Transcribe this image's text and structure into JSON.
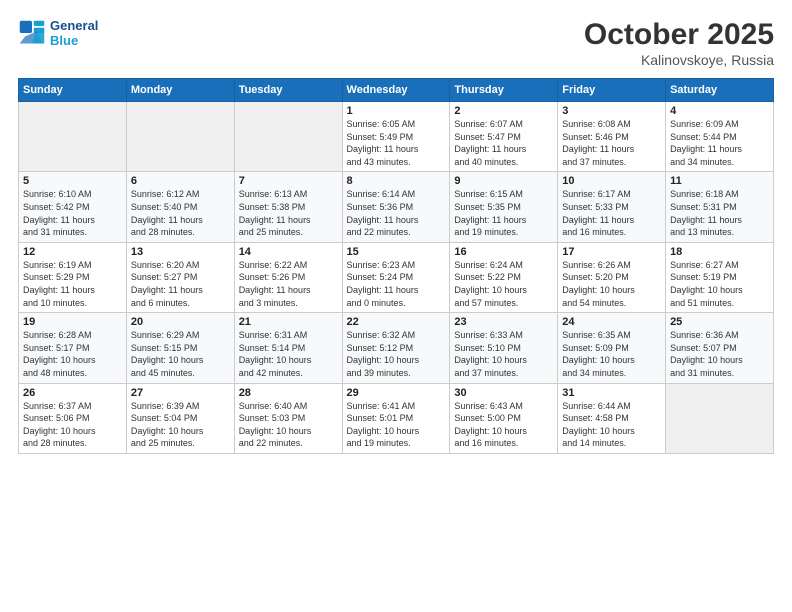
{
  "header": {
    "logo_line1": "General",
    "logo_line2": "Blue",
    "month": "October 2025",
    "location": "Kalinovskoye, Russia"
  },
  "weekdays": [
    "Sunday",
    "Monday",
    "Tuesday",
    "Wednesday",
    "Thursday",
    "Friday",
    "Saturday"
  ],
  "weeks": [
    [
      {
        "day": "",
        "info": ""
      },
      {
        "day": "",
        "info": ""
      },
      {
        "day": "",
        "info": ""
      },
      {
        "day": "1",
        "info": "Sunrise: 6:05 AM\nSunset: 5:49 PM\nDaylight: 11 hours\nand 43 minutes."
      },
      {
        "day": "2",
        "info": "Sunrise: 6:07 AM\nSunset: 5:47 PM\nDaylight: 11 hours\nand 40 minutes."
      },
      {
        "day": "3",
        "info": "Sunrise: 6:08 AM\nSunset: 5:46 PM\nDaylight: 11 hours\nand 37 minutes."
      },
      {
        "day": "4",
        "info": "Sunrise: 6:09 AM\nSunset: 5:44 PM\nDaylight: 11 hours\nand 34 minutes."
      }
    ],
    [
      {
        "day": "5",
        "info": "Sunrise: 6:10 AM\nSunset: 5:42 PM\nDaylight: 11 hours\nand 31 minutes."
      },
      {
        "day": "6",
        "info": "Sunrise: 6:12 AM\nSunset: 5:40 PM\nDaylight: 11 hours\nand 28 minutes."
      },
      {
        "day": "7",
        "info": "Sunrise: 6:13 AM\nSunset: 5:38 PM\nDaylight: 11 hours\nand 25 minutes."
      },
      {
        "day": "8",
        "info": "Sunrise: 6:14 AM\nSunset: 5:36 PM\nDaylight: 11 hours\nand 22 minutes."
      },
      {
        "day": "9",
        "info": "Sunrise: 6:15 AM\nSunset: 5:35 PM\nDaylight: 11 hours\nand 19 minutes."
      },
      {
        "day": "10",
        "info": "Sunrise: 6:17 AM\nSunset: 5:33 PM\nDaylight: 11 hours\nand 16 minutes."
      },
      {
        "day": "11",
        "info": "Sunrise: 6:18 AM\nSunset: 5:31 PM\nDaylight: 11 hours\nand 13 minutes."
      }
    ],
    [
      {
        "day": "12",
        "info": "Sunrise: 6:19 AM\nSunset: 5:29 PM\nDaylight: 11 hours\nand 10 minutes."
      },
      {
        "day": "13",
        "info": "Sunrise: 6:20 AM\nSunset: 5:27 PM\nDaylight: 11 hours\nand 6 minutes."
      },
      {
        "day": "14",
        "info": "Sunrise: 6:22 AM\nSunset: 5:26 PM\nDaylight: 11 hours\nand 3 minutes."
      },
      {
        "day": "15",
        "info": "Sunrise: 6:23 AM\nSunset: 5:24 PM\nDaylight: 11 hours\nand 0 minutes."
      },
      {
        "day": "16",
        "info": "Sunrise: 6:24 AM\nSunset: 5:22 PM\nDaylight: 10 hours\nand 57 minutes."
      },
      {
        "day": "17",
        "info": "Sunrise: 6:26 AM\nSunset: 5:20 PM\nDaylight: 10 hours\nand 54 minutes."
      },
      {
        "day": "18",
        "info": "Sunrise: 6:27 AM\nSunset: 5:19 PM\nDaylight: 10 hours\nand 51 minutes."
      }
    ],
    [
      {
        "day": "19",
        "info": "Sunrise: 6:28 AM\nSunset: 5:17 PM\nDaylight: 10 hours\nand 48 minutes."
      },
      {
        "day": "20",
        "info": "Sunrise: 6:29 AM\nSunset: 5:15 PM\nDaylight: 10 hours\nand 45 minutes."
      },
      {
        "day": "21",
        "info": "Sunrise: 6:31 AM\nSunset: 5:14 PM\nDaylight: 10 hours\nand 42 minutes."
      },
      {
        "day": "22",
        "info": "Sunrise: 6:32 AM\nSunset: 5:12 PM\nDaylight: 10 hours\nand 39 minutes."
      },
      {
        "day": "23",
        "info": "Sunrise: 6:33 AM\nSunset: 5:10 PM\nDaylight: 10 hours\nand 37 minutes."
      },
      {
        "day": "24",
        "info": "Sunrise: 6:35 AM\nSunset: 5:09 PM\nDaylight: 10 hours\nand 34 minutes."
      },
      {
        "day": "25",
        "info": "Sunrise: 6:36 AM\nSunset: 5:07 PM\nDaylight: 10 hours\nand 31 minutes."
      }
    ],
    [
      {
        "day": "26",
        "info": "Sunrise: 6:37 AM\nSunset: 5:06 PM\nDaylight: 10 hours\nand 28 minutes."
      },
      {
        "day": "27",
        "info": "Sunrise: 6:39 AM\nSunset: 5:04 PM\nDaylight: 10 hours\nand 25 minutes."
      },
      {
        "day": "28",
        "info": "Sunrise: 6:40 AM\nSunset: 5:03 PM\nDaylight: 10 hours\nand 22 minutes."
      },
      {
        "day": "29",
        "info": "Sunrise: 6:41 AM\nSunset: 5:01 PM\nDaylight: 10 hours\nand 19 minutes."
      },
      {
        "day": "30",
        "info": "Sunrise: 6:43 AM\nSunset: 5:00 PM\nDaylight: 10 hours\nand 16 minutes."
      },
      {
        "day": "31",
        "info": "Sunrise: 6:44 AM\nSunset: 4:58 PM\nDaylight: 10 hours\nand 14 minutes."
      },
      {
        "day": "",
        "info": ""
      }
    ]
  ]
}
